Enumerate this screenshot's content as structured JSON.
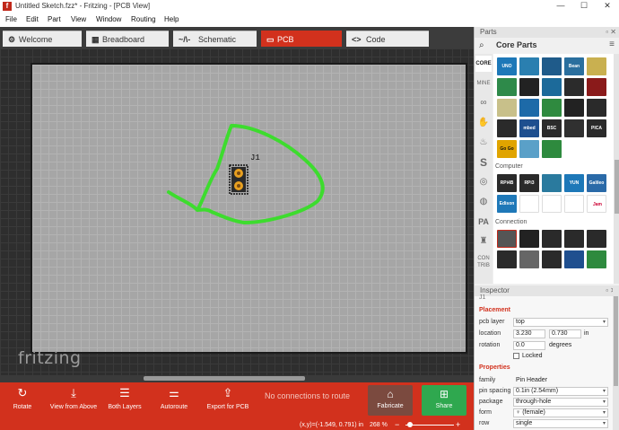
{
  "window": {
    "title": "Untitled Sketch.fzz* - Fritzing - [PCB View]",
    "app_icon_letter": "f",
    "minimize": "—",
    "maximize": "☐",
    "close": "✕"
  },
  "menu": [
    "File",
    "Edit",
    "Part",
    "View",
    "Window",
    "Routing",
    "Help"
  ],
  "tabs": [
    {
      "label": "Welcome",
      "icon": "gear-icon",
      "glyph": "⚙",
      "active": false
    },
    {
      "label": "Breadboard",
      "icon": "breadboard-icon",
      "glyph": "▦",
      "active": false
    },
    {
      "label": "Schematic",
      "icon": "schematic-icon",
      "glyph": "~/\\-",
      "active": false
    },
    {
      "label": "PCB",
      "icon": "pcb-icon",
      "glyph": "▭",
      "active": true
    },
    {
      "label": "Code",
      "icon": "code-icon",
      "glyph": "<>",
      "active": false
    }
  ],
  "canvas": {
    "watermark": "fritzing",
    "part_label": "J1",
    "trace_color": "#3ddc2e",
    "board_color": "#a6a6a6"
  },
  "toolbar": {
    "rotate": {
      "label": "Rotate",
      "icon": "rotate-icon",
      "glyph": "↻"
    },
    "view_from_above": {
      "label": "View from Above",
      "icon": "view-from-above-icon",
      "glyph": "⤓"
    },
    "both_layers": {
      "label": "Both Layers",
      "icon": "layers-icon",
      "glyph": "☰"
    },
    "autoroute": {
      "label": "Autoroute",
      "icon": "autoroute-icon",
      "glyph": "⚌"
    },
    "export_pcb": {
      "label": "Export for PCB",
      "icon": "export-icon",
      "glyph": "⇪"
    },
    "routing_status": "No connections to route",
    "fabricate": {
      "label": "Fabricate",
      "icon": "factory-icon",
      "glyph": "⌂"
    },
    "share": {
      "label": "Share",
      "icon": "share-icon",
      "glyph": "⊞"
    }
  },
  "statusbar": {
    "coords": "(x,y)=(-1.549, 0.791) in",
    "zoom": "268 %",
    "zoom_minus": "−",
    "zoom_plus": "+"
  },
  "parts": {
    "panel_title": "Parts",
    "bin_title": "Core Parts",
    "search_glyph": "⌕",
    "menu_glyph": "≡",
    "bins": [
      "CORE",
      "MINE",
      "∞",
      "✋",
      "♨",
      "S",
      "◎",
      "◍",
      "PA",
      "♜",
      "CON TRIB"
    ],
    "section_computer": "Computer",
    "section_connection": "Connection",
    "tiles_row1": [
      {
        "text": "UNO",
        "color": "#1d78b8"
      },
      {
        "text": "",
        "color": "#2a7fb0"
      },
      {
        "text": "",
        "color": "#1f5b8a"
      },
      {
        "text": "Bean",
        "color": "#2a6f9e"
      },
      {
        "text": "",
        "color": "#c9b050"
      }
    ],
    "tiles_row2": [
      {
        "text": "",
        "color": "#2e8a4a"
      },
      {
        "text": "",
        "color": "#222222"
      },
      {
        "text": "",
        "color": "#1c6a9a"
      },
      {
        "text": "",
        "color": "#2b2b2b"
      },
      {
        "text": "",
        "color": "#8a1a1a"
      }
    ],
    "tiles_row3": [
      {
        "text": "",
        "color": "#c8c08a"
      },
      {
        "text": "",
        "color": "#1d6aa8"
      },
      {
        "text": "",
        "color": "#2f8a3f"
      },
      {
        "text": "",
        "color": "#222222"
      },
      {
        "text": "",
        "color": "#2a2a2a"
      }
    ],
    "tiles_row4": [
      {
        "text": "",
        "color": "#2a2a2a"
      },
      {
        "text": "mbed",
        "color": "#1e4f8f"
      },
      {
        "text": "BSC",
        "color": "#2b2b2b"
      },
      {
        "text": "",
        "color": "#303030"
      },
      {
        "text": "PICA",
        "color": "#2a2a2a"
      }
    ],
    "tiles_row5": [
      {
        "text": "Go Go",
        "color": "#e0a400"
      },
      {
        "text": "",
        "color": "#5aa0c8"
      },
      {
        "text": "",
        "color": "#2e8a3e"
      }
    ],
    "tiles_computer1": [
      {
        "text": "RPi4B",
        "color": "#2a2a2a"
      },
      {
        "text": "RPi3",
        "color": "#2a2a2a"
      },
      {
        "text": "",
        "color": "#2a7a9e"
      },
      {
        "text": "YUN",
        "color": "#1d78b8"
      },
      {
        "text": "Galileo",
        "color": "#2a6aa8"
      }
    ],
    "tiles_computer2": [
      {
        "text": "Edison",
        "color": "#1e78b8"
      },
      {
        "text": "",
        "color": "#ffffff"
      },
      {
        "text": "",
        "color": "#ffffff"
      },
      {
        "text": "",
        "color": "#ffffff"
      },
      {
        "text": "Jam",
        "color": "#ffffff"
      }
    ],
    "tiles_connection1": [
      {
        "text": "",
        "color": "#555555"
      },
      {
        "text": "",
        "color": "#222222"
      },
      {
        "text": "",
        "color": "#2a2a2a"
      },
      {
        "text": "",
        "color": "#2a2a2a"
      },
      {
        "text": "",
        "color": "#2a2a2a"
      }
    ],
    "tiles_connection2": [
      {
        "text": "",
        "color": "#2a2a2a"
      },
      {
        "text": "",
        "color": "#666666"
      },
      {
        "text": "",
        "color": "#2a2a2a"
      },
      {
        "text": "",
        "color": "#1f4f8f"
      },
      {
        "text": "",
        "color": "#2e8a3e"
      }
    ]
  },
  "inspector": {
    "panel_title": "Inspector",
    "part_title": "J1",
    "placement_section": "Placement",
    "pcb_layer_label": "pcb layer",
    "pcb_layer_value": "top",
    "location_label": "location",
    "location_x": "3.230",
    "location_y": "0.730",
    "location_unit": "in",
    "rotation_label": "rotation",
    "rotation_value": "0.0",
    "rotation_unit": "degrees",
    "locked_label": "Locked",
    "properties_section": "Properties",
    "family_label": "family",
    "family_value": "Pin Header",
    "pin_spacing_label": "pin spacing",
    "pin_spacing_value": "0.1in (2.54mm)",
    "package_label": "package",
    "package_value": "through-hole",
    "form_label": "form",
    "form_value": "♀ (female)",
    "row_label": "row",
    "row_value": "single"
  }
}
